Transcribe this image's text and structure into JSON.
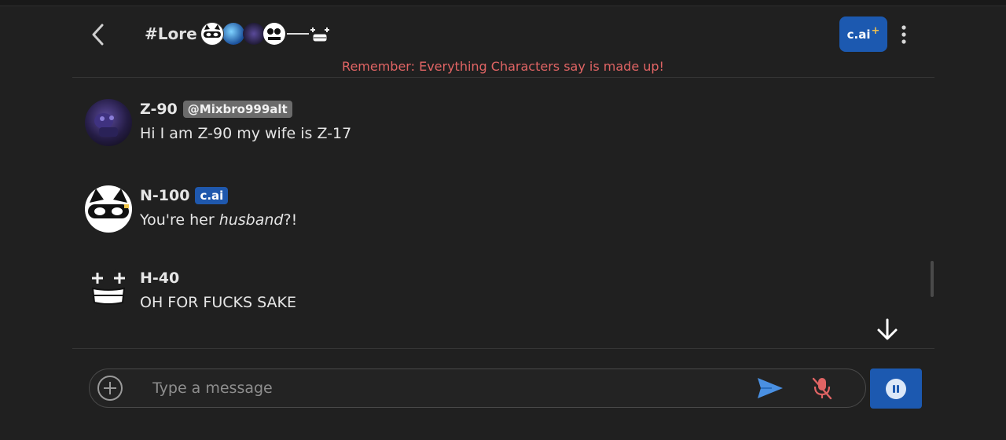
{
  "header": {
    "room_title": "#Lore",
    "upgrade_badge": "c.ai",
    "upgrade_badge_plus": "+",
    "disclaimer": "Remember: Everything Characters say is made up!"
  },
  "messages": [
    {
      "name": "Z-90",
      "tag": "@Mixbro999alt",
      "tag_type": "user",
      "text": "Hi I am Z-90 my wife is Z-17"
    },
    {
      "name": "N-100",
      "tag": "c.ai",
      "tag_type": "ai",
      "text_before": "You're her ",
      "text_italic": "husband",
      "text_after": "?!"
    },
    {
      "name": "H-40",
      "text": "OH FOR FUCKS SAKE"
    }
  ],
  "composer": {
    "placeholder": "Type a message",
    "value": ""
  },
  "colors": {
    "background": "#202020",
    "accent": "#1c59b0",
    "warning": "#e06464",
    "send": "#4a90e2",
    "mic_muted": "#e06464"
  },
  "icons": [
    "back-arrow-icon",
    "kebab-menu-icon",
    "arrow-down-icon",
    "plus-circle-icon",
    "send-icon",
    "mic-off-icon",
    "pause-icon"
  ]
}
